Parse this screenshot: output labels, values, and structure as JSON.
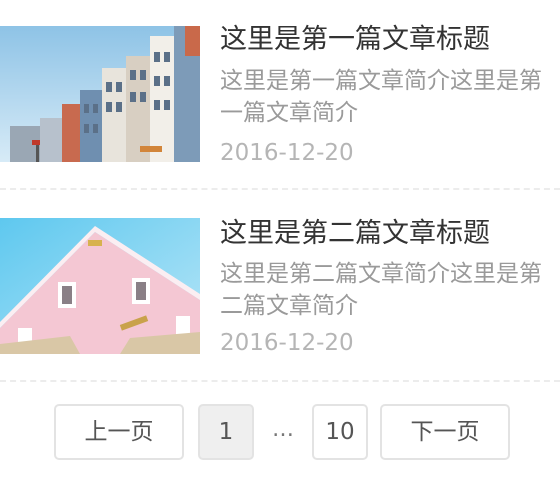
{
  "articles": [
    {
      "title": "这里是第一篇文章标题",
      "summary": "这里是第一篇文章简介这里是第一篇文章简介",
      "date": "2016-12-20",
      "thumbnail": "colorful-townhouses-photo"
    },
    {
      "title": "这里是第二篇文章标题",
      "summary": "这里是第二篇文章简介这里是第二篇文章简介",
      "date": "2016-12-20",
      "thumbnail": "pink-building-photo"
    }
  ],
  "pagination": {
    "prev_label": "上一页",
    "current_page": "1",
    "ellipsis": "…",
    "last_page": "10",
    "next_label": "下一页"
  },
  "colors": {
    "title": "#333333",
    "summary": "#9a9a9a",
    "date": "#b5b5b5",
    "divider": "#ececec",
    "button_border": "#e3e3e3",
    "active_page_bg": "#efefef"
  }
}
